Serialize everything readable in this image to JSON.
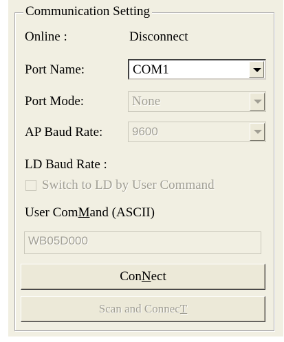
{
  "group": {
    "title": "Communication Setting"
  },
  "online": {
    "label": "Online :",
    "value": "Disconnect"
  },
  "port_name": {
    "label": "Port Name:",
    "value": "COM1"
  },
  "port_mode": {
    "label": "Port Mode:",
    "value": "None"
  },
  "ap_baud": {
    "label": "AP Baud Rate:",
    "value": "9600"
  },
  "ld_baud": {
    "label": "LD Baud Rate :"
  },
  "switch_ld": {
    "label": "Switch to LD by User Command",
    "checked": false
  },
  "user_command": {
    "label_pre": "User Com",
    "label_u": "M",
    "label_post": "and (ASCII)",
    "value": "WB05D000"
  },
  "connect_button": {
    "pre": "Con",
    "u": "N",
    "post": "ect"
  },
  "scan_button": {
    "pre": "Scan and Connec",
    "u": "T",
    "post": ""
  }
}
